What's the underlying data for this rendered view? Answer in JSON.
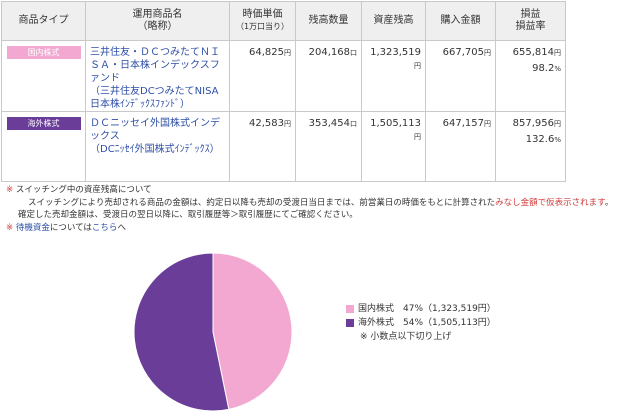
{
  "table": {
    "headers": {
      "product_type": "商品タイプ",
      "fund_name_1": "運用商品名",
      "fund_name_2": "（略称）",
      "unit_price_1": "時価単価",
      "unit_price_2": "（1万口当り）",
      "units": "残高数量",
      "balance": "資産残高",
      "purchase": "購入金額",
      "pl_1": "損益",
      "pl_2": "損益率"
    },
    "rows": [
      {
        "badge": "国内株式",
        "fund_name": "三井住友・ＤＣつみたてＮＩＳＡ・日本株インデックスファンド",
        "fund_short": "（三井住友DCつみたてNISA日本株ｲﾝﾃﾞｯｸｽﾌｧﾝﾄﾞ）",
        "unit_price": "64,825",
        "unit_price_unit": "円",
        "units": "204,168",
        "units_unit": "口",
        "balance": "1,323,519",
        "balance_unit": "円",
        "purchase": "667,705",
        "purchase_unit": "円",
        "pl": "655,814",
        "pl_unit": "円",
        "pl_rate": "98.2",
        "pl_rate_unit": "%"
      },
      {
        "badge": "海外株式",
        "fund_name": "ＤＣニッセイ外国株式インデックス",
        "fund_short": "（DCﾆｯｾｲ外国株式ｲﾝﾃﾞｯｸｽ）",
        "unit_price": "42,583",
        "unit_price_unit": "円",
        "units": "353,454",
        "units_unit": "口",
        "balance": "1,505,113",
        "balance_unit": "円",
        "purchase": "647,157",
        "purchase_unit": "円",
        "pl": "857,956",
        "pl_unit": "円",
        "pl_rate": "132.6",
        "pl_rate_unit": "%"
      }
    ]
  },
  "notes": {
    "mark": "※",
    "title": "スイッチング中の資産残高について",
    "line2_a": "スイッチングにより売却される商品の金額は、約定日以降も売却の受渡日当日までは、前営業日の時価をもとに計算された",
    "line2_b": "みなし金額で仮表示されます",
    "line2_c": "。",
    "line3": "確定した売却金額は、受渡日の翌日以降に、取引履歴等＞取引履歴にてご確認ください。",
    "wait_a": "待機資金",
    "wait_b": "については",
    "wait_link": "こちら",
    "wait_c": "へ"
  },
  "legend": {
    "domestic": "国内株式　47%（1,323,519円）",
    "foreign": "海外株式　54%（1,505,113円）",
    "note": "※ 小数点以下切り上げ"
  },
  "colors": {
    "domestic": "#f2a8d0",
    "foreign": "#6a3d98"
  },
  "chart_data": {
    "type": "pie",
    "categories": [
      "国内株式",
      "海外株式"
    ],
    "values": [
      1323519,
      1505113
    ],
    "percent_labels": [
      "47%",
      "54%"
    ]
  }
}
